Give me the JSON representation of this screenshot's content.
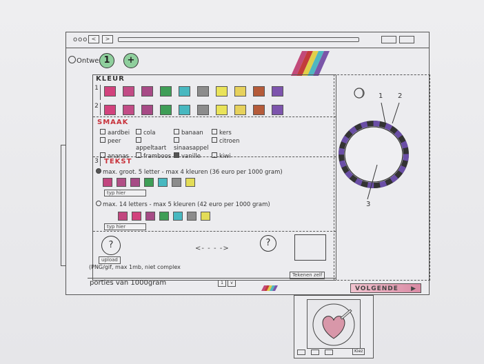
{
  "window": {
    "dots": "ooo",
    "back": "<",
    "forward": ">"
  },
  "header": {
    "label": "Ontwerp:",
    "step1": "1",
    "step2": "+"
  },
  "kleur": {
    "title": "KLEUR",
    "row1_num": "1",
    "row2_num": "2",
    "swatches_row1": [
      "#d2427d",
      "#c24c86",
      "#a74a86",
      "#3f9e57",
      "#48b8c0",
      "#8c8c8c",
      "#e9e35a",
      "#e6d15c",
      "#b55b3a",
      "#7d54ad"
    ],
    "swatches_row2": [
      "#d2427d",
      "#c24c86",
      "#a74a86",
      "#3f9e57",
      "#48b8c0",
      "#8c8c8c",
      "#e9e35a",
      "#e6d15c",
      "#b55b3a",
      "#7d54ad"
    ]
  },
  "smaak": {
    "title": "SMAAK",
    "options": [
      {
        "label": "aardbei",
        "checked": false
      },
      {
        "label": "cola",
        "checked": false
      },
      {
        "label": "banaan",
        "checked": false
      },
      {
        "label": "kers",
        "checked": false
      },
      {
        "label": "peer",
        "checked": false
      },
      {
        "label": "appeltaart",
        "checked": false
      },
      {
        "label": "sinaasappel",
        "checked": false
      },
      {
        "label": "citroen",
        "checked": false
      },
      {
        "label": "ananas",
        "checked": false
      },
      {
        "label": "framboos",
        "checked": false
      },
      {
        "label": "vanille",
        "checked": true
      },
      {
        "label": "kiwi",
        "checked": false
      }
    ]
  },
  "tekst": {
    "num": "3",
    "title": "TEKST",
    "option1": "max. groot. 5 letter - max 4 kleuren (36 euro per 1000 gram)",
    "option1_swatches": [
      "#c2467f",
      "#b14f86",
      "#a64b86",
      "#3f9e57",
      "#48b8c0",
      "#8c8c8c",
      "#e3dc57"
    ],
    "input1_placeholder": "typ hier",
    "option2": "max. 14 letters - max 5 kleuren (42 euro per 1000 gram)",
    "option2_swatches": [
      "#c2467f",
      "#d2427d",
      "#a64b86",
      "#3f9e57",
      "#48b8c0",
      "#8c8c8c",
      "#e3dc57"
    ],
    "input2_placeholder": "typ hier"
  },
  "upload": {
    "help1": "?",
    "button": "upload",
    "note": "(PNG/gif, max 1mb, niet complex",
    "help2": "?",
    "draw_button": "Tekenen zelf"
  },
  "footer": {
    "portions": "porties van 1000gram",
    "select_value": "1",
    "select_arrow": "v"
  },
  "preview": {
    "callout1": "1",
    "callout2": "2",
    "callout3": "3"
  },
  "next": {
    "label": "VOLGENDE",
    "arrow": "▶"
  },
  "popup": {
    "button": "Kiez"
  }
}
